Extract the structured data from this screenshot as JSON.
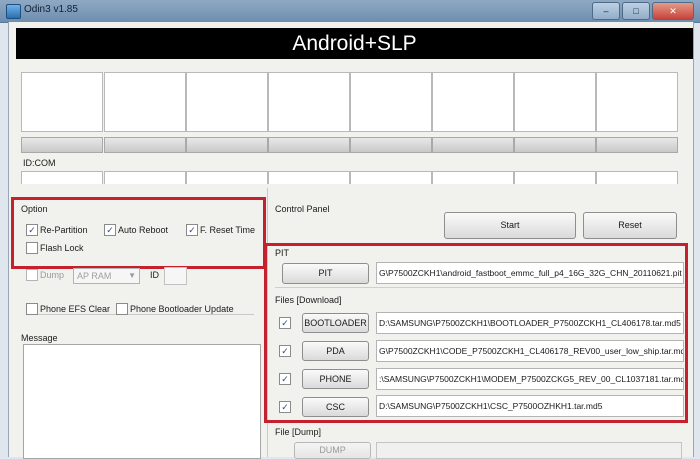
{
  "window": {
    "title": "Odin3 v1.85",
    "buttons": [
      "–",
      "□",
      "✕"
    ]
  },
  "banner": "Android+SLP",
  "slots": {
    "id_com_label": "ID:COM"
  },
  "option": {
    "title": "Option",
    "re_partition": {
      "label": "Re-Partition",
      "checked": true
    },
    "auto_reboot": {
      "label": "Auto Reboot",
      "checked": true
    },
    "f_reset_time": {
      "label": "F. Reset Time",
      "checked": true
    },
    "flash_lock": {
      "label": "Flash Lock",
      "checked": false
    },
    "dump": {
      "label": "Dump",
      "checked": false
    },
    "ap_ram": "AP RAM",
    "id_label": "ID",
    "phone_efs_clear": {
      "label": "Phone EFS Clear",
      "checked": false
    },
    "phone_bootloader_update": {
      "label": "Phone Bootloader Update",
      "checked": false
    }
  },
  "message": {
    "label": "Message"
  },
  "control_panel": {
    "label": "Control Panel",
    "start": "Start",
    "reset": "Reset"
  },
  "pit": {
    "label": "PIT",
    "button": "PIT",
    "path": "G\\P7500ZCKH1\\android_fastboot_emmc_full_p4_16G_32G_CHN_20110621.pit"
  },
  "files_download": {
    "label": "Files [Download]",
    "rows": [
      {
        "button": "BOOTLOADER",
        "checked": true,
        "path": "D:\\SAMSUNG\\P7500ZCKH1\\BOOTLOADER_P7500ZCKH1_CL406178.tar.md5"
      },
      {
        "button": "PDA",
        "checked": true,
        "path": "G\\P7500ZCKH1\\CODE_P7500ZCKH1_CL406178_REV00_user_low_ship.tar.md5"
      },
      {
        "button": "PHONE",
        "checked": true,
        "path": ":\\SAMSUNG\\P7500ZCKH1\\MODEM_P7500ZCKG5_REV_00_CL1037181.tar.md5"
      },
      {
        "button": "CSC",
        "checked": true,
        "path": "D:\\SAMSUNG\\P7500ZCKH1\\CSC_P7500OZHKH1.tar.md5"
      }
    ]
  },
  "file_dump": {
    "label": "File [Dump]",
    "button": "DUMP"
  }
}
